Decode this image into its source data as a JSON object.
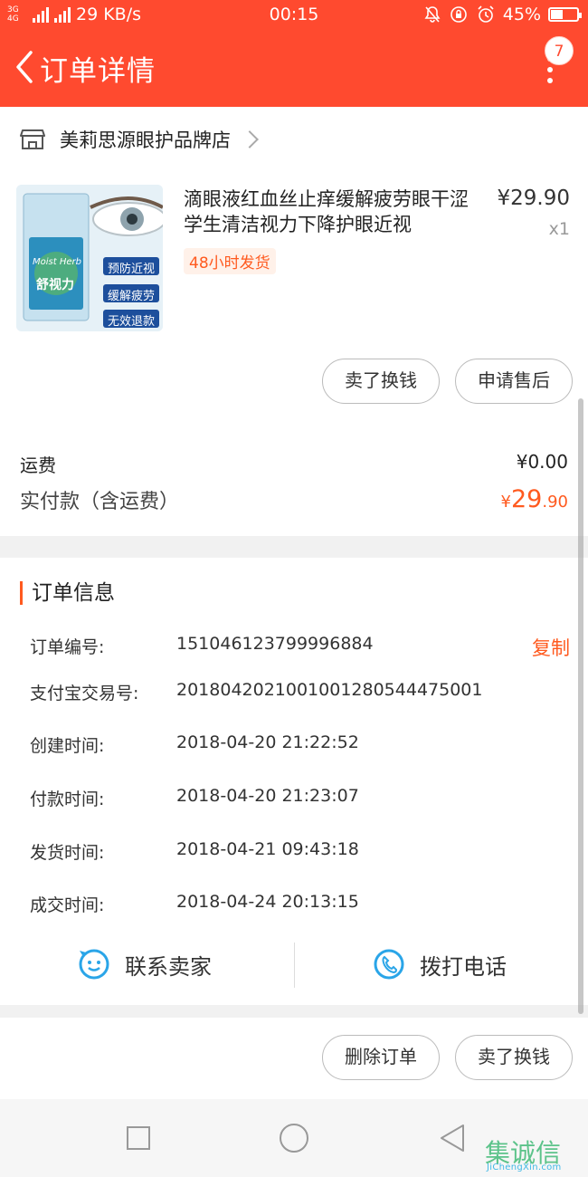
{
  "status_bar": {
    "network": "3G 4G",
    "speed": "29 KB/s",
    "time": "00:15",
    "battery": "45%",
    "battery_level": 0.45
  },
  "header": {
    "title": "订单详情",
    "badge_count": "7"
  },
  "shop": {
    "name": "美莉思源眼护品牌店"
  },
  "product": {
    "title": "滴眼液红血丝止痒缓解疲劳眼干涩学生清洁视力下降护眼近视",
    "price": "¥29.90",
    "quantity": "x1",
    "shipping_tag": "48小时发货",
    "image_texts": [
      "预防近视",
      "缓解疲劳",
      "无效退款",
      "舒视力",
      "Moist Herb"
    ]
  },
  "item_buttons": {
    "sell": "卖了换钱",
    "after_sale": "申请售后"
  },
  "fees": {
    "shipping_label": "运费",
    "shipping_value": "¥0.00",
    "paid_label": "实付款（含运费）",
    "paid_currency": "¥",
    "paid_integer": "29",
    "paid_decimal": ".90"
  },
  "order_info": {
    "section_title": "订单信息",
    "copy_label": "复制",
    "rows": [
      {
        "label": "订单编号:",
        "value": "151046123799996884"
      },
      {
        "label": "支付宝交易号:",
        "value": "2018042021001001280544475001"
      },
      {
        "label": "创建时间:",
        "value": "2018-04-20 21:22:52"
      },
      {
        "label": "付款时间:",
        "value": "2018-04-20 21:23:07"
      },
      {
        "label": "发货时间:",
        "value": "2018-04-21 09:43:18"
      },
      {
        "label": "成交时间:",
        "value": "2018-04-24 20:13:15"
      }
    ],
    "contact_seller": "联系卖家",
    "call_phone": "拨打电话"
  },
  "bottom_buttons": {
    "delete": "删除订单",
    "sell": "卖了换钱"
  },
  "watermark": {
    "logo": "集诚信",
    "url": "JiChengXin.com"
  },
  "colors": {
    "brand": "#ff4a2f",
    "accent": "#ff5a1f",
    "icon_blue": "#2aa5e8"
  }
}
